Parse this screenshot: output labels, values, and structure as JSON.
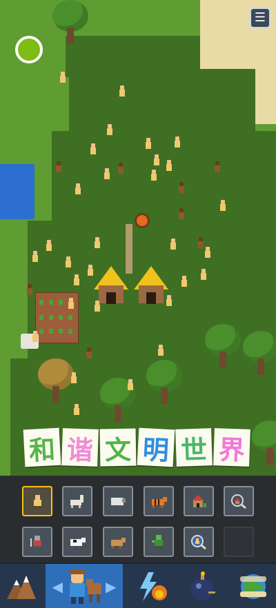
{
  "title_banner": {
    "characters": [
      {
        "char": "和",
        "color": "#58b447"
      },
      {
        "char": "谐",
        "color": "#f08bd6"
      },
      {
        "char": "文",
        "color": "#4fb54a"
      },
      {
        "char": "明",
        "color": "#2f8fe0"
      },
      {
        "char": "世",
        "color": "#49b86a"
      },
      {
        "char": "界",
        "color": "#f07ad4"
      }
    ]
  },
  "top_controls": {
    "menu_icon": "hamburger-menu-icon",
    "location_indicator_color": "#7fbc14"
  },
  "toolbar": {
    "row1": [
      {
        "name": "human",
        "icon": "human-icon",
        "selected": true
      },
      {
        "name": "llama",
        "icon": "llama-icon",
        "selected": false
      },
      {
        "name": "sheep",
        "icon": "sheep-icon",
        "selected": false
      },
      {
        "name": "tiger",
        "icon": "tiger-icon",
        "selected": false
      },
      {
        "name": "house",
        "icon": "house-icon",
        "selected": false
      },
      {
        "name": "inspect-village",
        "icon": "magnifier-house-icon",
        "selected": false
      }
    ],
    "row2": [
      {
        "name": "knight",
        "icon": "knight-icon",
        "selected": false
      },
      {
        "name": "cow",
        "icon": "cow-icon",
        "selected": false
      },
      {
        "name": "bear",
        "icon": "bear-icon",
        "selected": false
      },
      {
        "name": "zombie",
        "icon": "zombie-icon",
        "selected": false
      },
      {
        "name": "inspect-unit",
        "icon": "magnifier-icon",
        "selected": false
      },
      {
        "name": "empty",
        "icon": "",
        "selected": false
      }
    ]
  },
  "bottom_nav": [
    {
      "name": "terrain",
      "icon": "mountain-icon",
      "selected": false
    },
    {
      "name": "creatures",
      "icon": "villager-cow-icon",
      "selected": true
    },
    {
      "name": "powers",
      "icon": "lightning-fire-icon",
      "selected": false
    },
    {
      "name": "bombs",
      "icon": "bomb-icon",
      "selected": false
    },
    {
      "name": "world-laws",
      "icon": "scroll-globe-icon",
      "selected": false
    }
  ],
  "colors": {
    "grass": "#5f9d33",
    "forest": "#3f6f22",
    "water": "#2c6fd0",
    "sand": "#e9dba6",
    "toolbar_bg": "#2a2d30",
    "selected_border": "#f6c11a",
    "nav_selected": "#2f6fba"
  }
}
